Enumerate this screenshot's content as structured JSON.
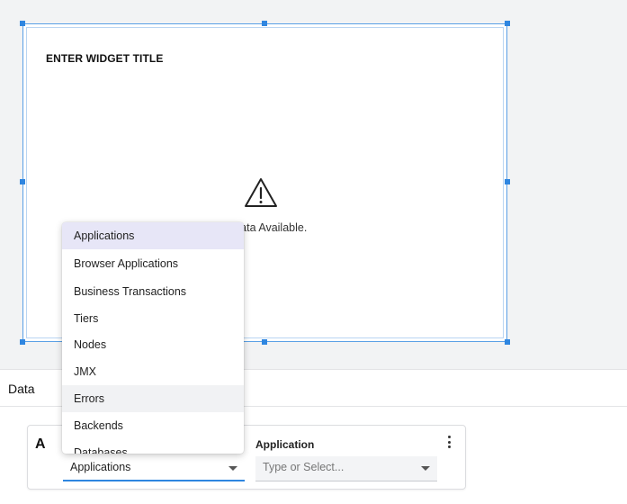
{
  "widget": {
    "title": "ENTER WIDGET TITLE",
    "message": "No Data Available.",
    "icon": "warning-triangle-icon"
  },
  "data_section": {
    "label": "Data"
  },
  "query": {
    "letter": "A",
    "source": {
      "selected": "Applications"
    },
    "application": {
      "label": "Application",
      "placeholder": "Type or Select..."
    }
  },
  "dropdown": {
    "items": [
      {
        "label": "Applications",
        "state": "selected"
      },
      {
        "label": "Browser Applications",
        "state": ""
      },
      {
        "label": "Business Transactions",
        "state": ""
      },
      {
        "label": "Tiers",
        "state": ""
      },
      {
        "label": "Nodes",
        "state": ""
      },
      {
        "label": "JMX",
        "state": ""
      },
      {
        "label": "Errors",
        "state": "hover"
      },
      {
        "label": "Backends",
        "state": ""
      },
      {
        "label": "Databases",
        "state": ""
      }
    ]
  },
  "colors": {
    "selection_border": "#2f86e0",
    "selected_item_bg": "#e7e6f7",
    "hover_item_bg": "#f1f2f4",
    "canvas_bg": "#f2f3f4"
  }
}
